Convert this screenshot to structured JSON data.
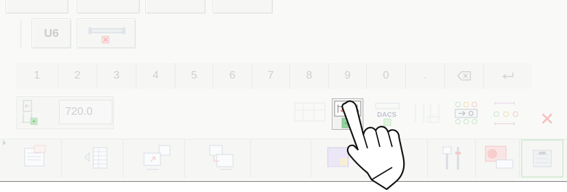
{
  "header": {
    "u6_label": "U6"
  },
  "keypad": {
    "keys": [
      "1",
      "2",
      "3",
      "4",
      "5",
      "6",
      "7",
      "8",
      "9",
      "0",
      "."
    ]
  },
  "value_field": {
    "value": "720.0"
  },
  "icons": {
    "backspace": "backspace-icon",
    "enter": "enter-arrow-icon",
    "close": "close-icon",
    "pointer": "hand-pointer-icon"
  },
  "close_label": "✕",
  "colors": {
    "accent_green": "#37b34a",
    "close_red": "#f08a8a",
    "highlight_border": "#9bd39b"
  }
}
